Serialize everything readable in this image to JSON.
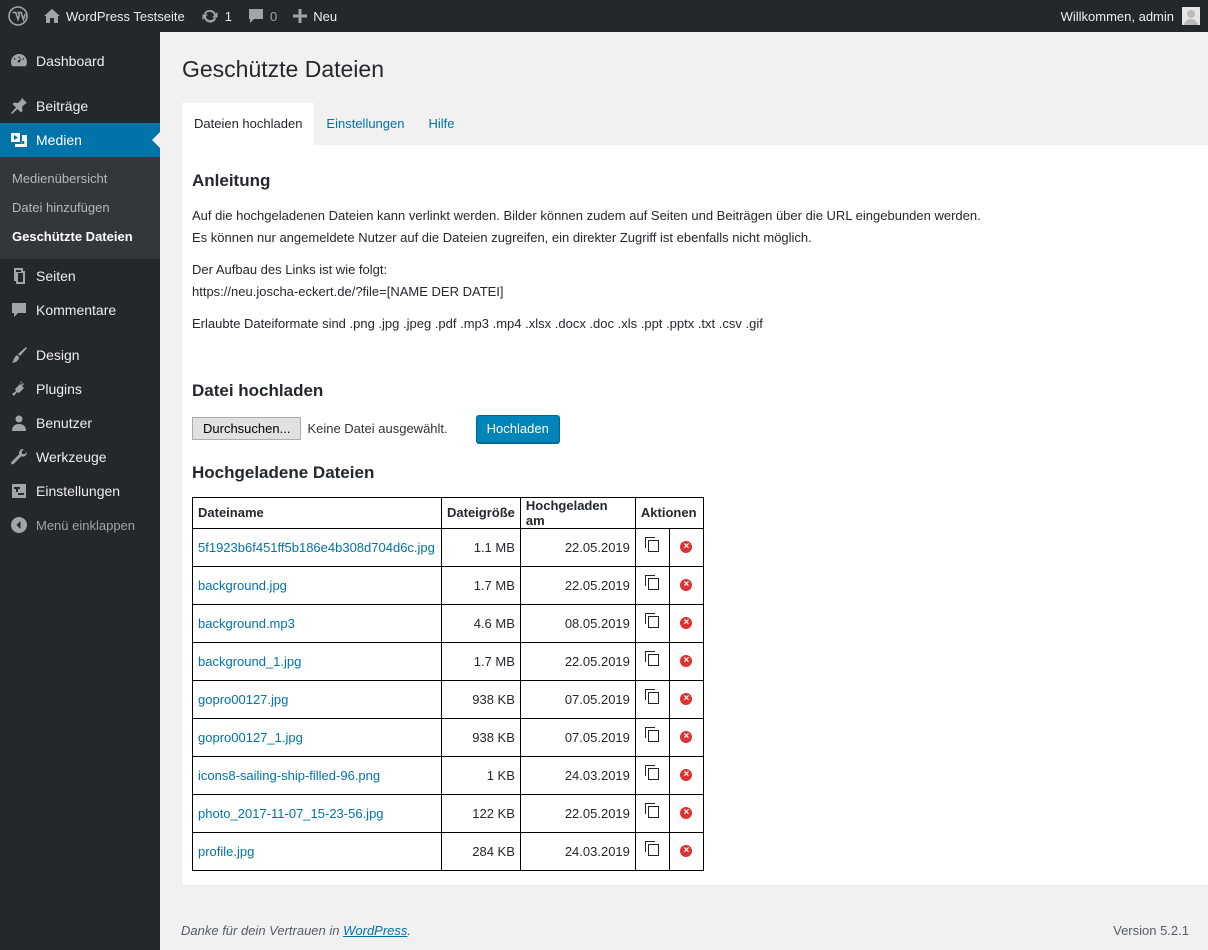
{
  "adminbar": {
    "site_name": "WordPress Testseite",
    "updates_count": "1",
    "comments_count": "0",
    "new_label": "Neu",
    "greeting": "Willkommen, admin"
  },
  "sidebar": {
    "items": [
      {
        "label": "Dashboard",
        "icon": "dashboard-icon"
      },
      {
        "label": "Beiträge",
        "icon": "pin-icon"
      },
      {
        "label": "Medien",
        "icon": "media-icon"
      },
      {
        "label": "Seiten",
        "icon": "pages-icon"
      },
      {
        "label": "Kommentare",
        "icon": "comments-icon"
      },
      {
        "label": "Design",
        "icon": "brush-icon"
      },
      {
        "label": "Plugins",
        "icon": "plugin-icon"
      },
      {
        "label": "Benutzer",
        "icon": "users-icon"
      },
      {
        "label": "Werkzeuge",
        "icon": "wrench-icon"
      },
      {
        "label": "Einstellungen",
        "icon": "settings-icon"
      }
    ],
    "submenu": [
      "Medienübersicht",
      "Datei hinzufügen",
      "Geschützte Dateien"
    ],
    "collapse_label": "Menü einklappen",
    "active_color": "#0073aa"
  },
  "page": {
    "title": "Geschützte Dateien",
    "tabs": [
      "Dateien hochladen",
      "Einstellungen",
      "Hilfe"
    ]
  },
  "instructions": {
    "heading": "Anleitung",
    "line1": "Auf die hochgeladenen Dateien kann verlinkt werden. Bilder können zudem auf Seiten und Beiträgen über die URL eingebunden werden.",
    "line2": "Es können nur angemeldete Nutzer auf die Dateien zugreifen, ein direkter Zugriff ist ebenfalls nicht möglich.",
    "link_intro": "Der Aufbau des Links ist wie folgt:",
    "link_format": "https://neu.joscha-eckert.de/?file=[NAME DER DATEI]",
    "formats": "Erlaubte Dateiformate sind .png .jpg .jpeg .pdf .mp3 .mp4 .xlsx .docx .doc .xls .ppt .pptx .txt .csv .gif"
  },
  "upload": {
    "heading": "Datei hochladen",
    "browse_label": "Durchsuchen...",
    "no_file": "Keine Datei ausgewählt.",
    "submit_label": "Hochladen"
  },
  "files": {
    "heading": "Hochgeladene Dateien",
    "columns": [
      "Dateiname",
      "Dateigröße",
      "Hochgeladen am",
      "Aktionen"
    ],
    "rows": [
      {
        "name": "5f1923b6f451ff5b186e4b308d704d6c.jpg",
        "size": "1.1 MB",
        "date": "22.05.2019"
      },
      {
        "name": "background.jpg",
        "size": "1.7 MB",
        "date": "22.05.2019"
      },
      {
        "name": "background.mp3",
        "size": "4.6 MB",
        "date": "08.05.2019"
      },
      {
        "name": "background_1.jpg",
        "size": "1.7 MB",
        "date": "22.05.2019"
      },
      {
        "name": "gopro00127.jpg",
        "size": "938 KB",
        "date": "07.05.2019"
      },
      {
        "name": "gopro00127_1.jpg",
        "size": "938 KB",
        "date": "07.05.2019"
      },
      {
        "name": "icons8-sailing-ship-filled-96.png",
        "size": "1 KB",
        "date": "24.03.2019"
      },
      {
        "name": "photo_2017-11-07_15-23-56.jpg",
        "size": "122 KB",
        "date": "22.05.2019"
      },
      {
        "name": "profile.jpg",
        "size": "284 KB",
        "date": "24.03.2019"
      }
    ]
  },
  "footer": {
    "thanks_prefix": "Danke für dein Vertrauen in ",
    "thanks_link": "WordPress",
    "thanks_suffix": ".",
    "version": "Version 5.2.1"
  }
}
